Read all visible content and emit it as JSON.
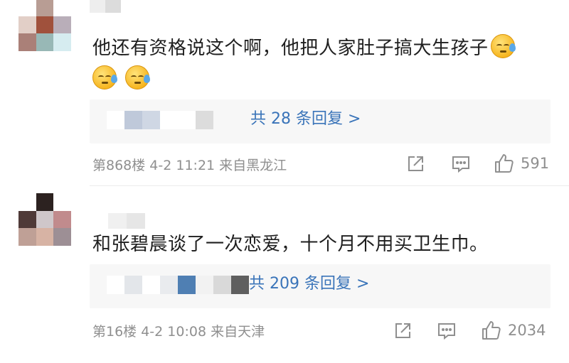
{
  "comments": [
    {
      "text": "他还有资格说这个啊，他把人家肚子搞大生孩子",
      "emoji_count": 3,
      "emoji_icon": "cold-sweat-emoji",
      "reply_link": "共 28 条回复 >",
      "meta": "第868楼 4-2 11:21 来自黑龙江",
      "likes": "591",
      "avatar_colors": [
        "#ffffff",
        "#b89d94",
        "#ffffff",
        "#e2cfc7",
        "#a0513c",
        "#b9aeb9",
        "#aa8078",
        "#98b8b6",
        "#d6ecf0"
      ],
      "name_colors": [
        "#eeeeee",
        "#dcdcdc",
        "#ffffff"
      ],
      "reply_blur_colors": [
        "#ffffff",
        "#bfc9da",
        "#cfd7e4",
        "#ffffff",
        "#ffffff",
        "#dcdcdc"
      ]
    },
    {
      "text": "和张碧晨谈了一次恋爱，十个月不用买卫生巾。",
      "reply_link": "共 209 条回复 >",
      "meta": "第16楼 4-2 10:08 来自天津",
      "likes": "2034",
      "avatar_colors": [
        "#ffffff",
        "#2c2220",
        "#ffffff",
        "#4f3a38",
        "#cfc7ca",
        "#c18b8d",
        "#bfa096",
        "#d7b3a4",
        "#9d8f95"
      ],
      "name_colors": [
        "#ffffff",
        "#f0f0f0",
        "#e6e6e6"
      ],
      "reply_blur_colors": [
        "#ffffff",
        "#e3e6ea",
        "#ffffff",
        "#e9ebee",
        "#4f7fb3",
        "#f2f2f2",
        "#d9d9d9",
        "#5f5f5f"
      ]
    }
  ],
  "icons": {
    "share": "share-icon",
    "comment": "comment-icon",
    "like": "thumbs-up-icon"
  },
  "colors": {
    "link": "#3a74b9",
    "meta": "#8f8f8f",
    "reply_bg": "#f7f7f7"
  }
}
